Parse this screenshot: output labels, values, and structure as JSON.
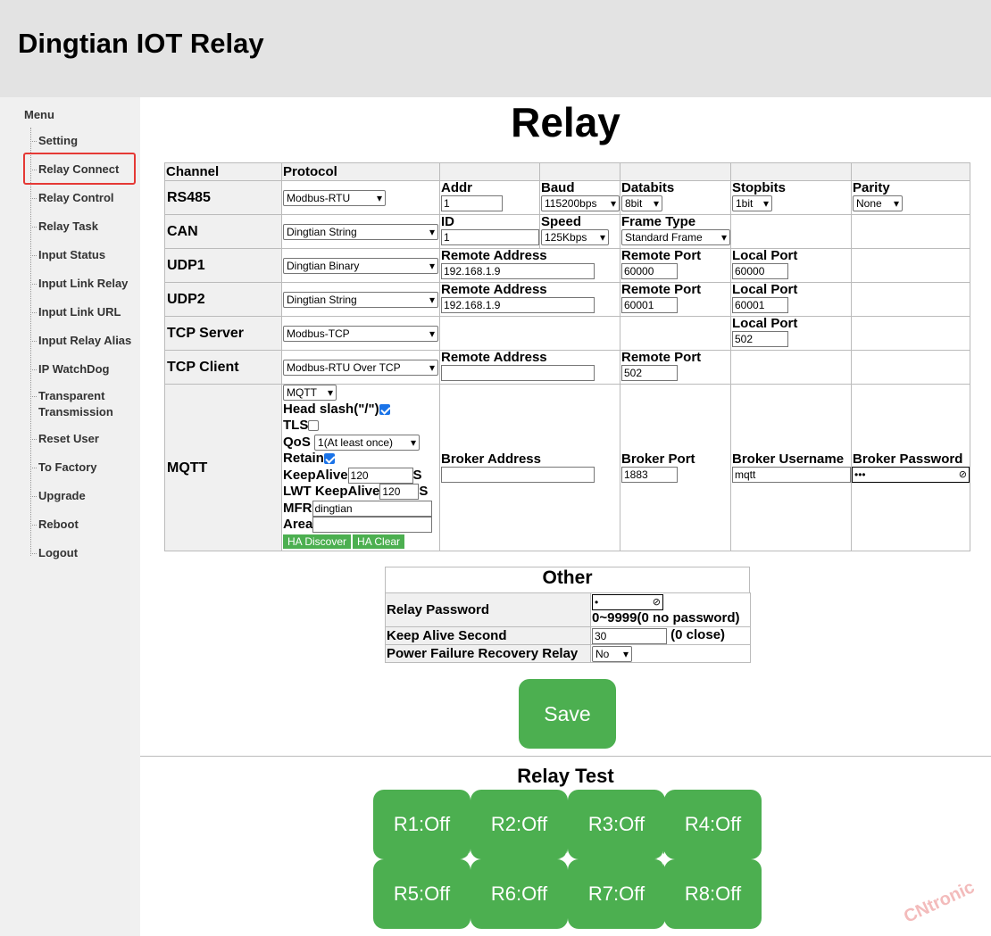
{
  "header": {
    "title": "Dingtian IOT Relay"
  },
  "sidebar": {
    "menu_label": "Menu",
    "items": [
      {
        "label": "Setting"
      },
      {
        "label": "Relay Connect",
        "active": true
      },
      {
        "label": "Relay Control"
      },
      {
        "label": "Relay Task"
      },
      {
        "label": "Input Status"
      },
      {
        "label": "Input Link Relay"
      },
      {
        "label": "Input Link URL"
      },
      {
        "label": "Input Relay Alias"
      },
      {
        "label": "IP WatchDog"
      },
      {
        "label": "Transparent Transmission"
      },
      {
        "label": "Reset User"
      },
      {
        "label": "To Factory"
      },
      {
        "label": "Upgrade"
      },
      {
        "label": "Reboot"
      },
      {
        "label": "Logout"
      }
    ]
  },
  "main": {
    "title": "Relay"
  },
  "table": {
    "headers": {
      "channel": "Channel",
      "protocol": "Protocol"
    },
    "rs485": {
      "channel": "RS485",
      "protocol": "Modbus-RTU",
      "addr_label": "Addr",
      "addr": "1",
      "baud_label": "Baud",
      "baud": "115200bps",
      "databits_label": "Databits",
      "databits": "8bit",
      "stopbits_label": "Stopbits",
      "stopbits": "1bit",
      "parity_label": "Parity",
      "parity": "None"
    },
    "can": {
      "channel": "CAN",
      "protocol": "Dingtian String",
      "id_label": "ID",
      "id": "1",
      "speed_label": "Speed",
      "speed": "125Kbps",
      "frame_label": "Frame Type",
      "frame": "Standard Frame"
    },
    "udp1": {
      "channel": "UDP1",
      "protocol": "Dingtian Binary",
      "remote_addr_label": "Remote Address",
      "remote_addr": "192.168.1.9",
      "remote_port_label": "Remote Port",
      "remote_port": "60000",
      "local_port_label": "Local Port",
      "local_port": "60000"
    },
    "udp2": {
      "channel": "UDP2",
      "protocol": "Dingtian String",
      "remote_addr_label": "Remote Address",
      "remote_addr": "192.168.1.9",
      "remote_port_label": "Remote Port",
      "remote_port": "60001",
      "local_port_label": "Local Port",
      "local_port": "60001"
    },
    "tcp_server": {
      "channel": "TCP Server",
      "protocol": "Modbus-TCP",
      "local_port_label": "Local Port",
      "local_port": "502"
    },
    "tcp_client": {
      "channel": "TCP Client",
      "protocol": "Modbus-RTU Over TCP",
      "remote_addr_label": "Remote Address",
      "remote_addr": "",
      "remote_port_label": "Remote Port",
      "remote_port": "502"
    },
    "mqtt": {
      "channel": "MQTT",
      "protocol": "MQTT",
      "head_slash_label": "Head slash(\"/\")",
      "head_slash": true,
      "tls_label": "TLS",
      "tls": false,
      "qos_label": "QoS",
      "qos": "1(At least once)",
      "retain_label": "Retain",
      "retain": true,
      "keepalive_label": "KeepAlive",
      "keepalive": "120",
      "keepalive_unit": "S",
      "lwt_label": "LWT KeepAlive",
      "lwt": "120",
      "lwt_unit": "S",
      "mfr_label": "MFR",
      "mfr": "dingtian",
      "area_label": "Area",
      "area": "",
      "ha_discover": "HA Discover",
      "ha_clear": "HA Clear",
      "broker_addr_label": "Broker Address",
      "broker_addr": "",
      "broker_port_label": "Broker Port",
      "broker_port": "1883",
      "broker_user_label": "Broker Username",
      "broker_user": "mqtt",
      "broker_pass_label": "Broker Password",
      "broker_pass": "•••"
    }
  },
  "other": {
    "title": "Other",
    "relay_password_label": "Relay Password",
    "relay_password": "•",
    "relay_password_hint": "0~9999(0 no password)",
    "keepalive_label": "Keep Alive Second",
    "keepalive": "30",
    "keepalive_hint": "(0 close)",
    "pfr_label": "Power Failure Recovery Relay",
    "pfr": "No"
  },
  "save_label": "Save",
  "relay_test": {
    "title": "Relay Test",
    "buttons": [
      "R1:Off",
      "R2:Off",
      "R3:Off",
      "R4:Off",
      "R5:Off",
      "R6:Off",
      "R7:Off",
      "R8:Off"
    ]
  },
  "watermark": "CNtronic",
  "colors": {
    "accent": "#4caf50",
    "highlight": "#e53935",
    "checkbox": "#1a73e8"
  }
}
